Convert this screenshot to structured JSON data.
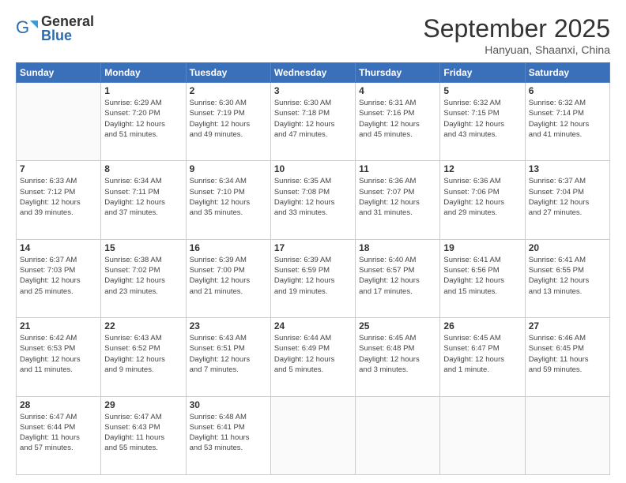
{
  "logo": {
    "general": "General",
    "blue": "Blue"
  },
  "header": {
    "month_title": "September 2025",
    "location": "Hanyuan, Shaanxi, China"
  },
  "weekdays": [
    "Sunday",
    "Monday",
    "Tuesday",
    "Wednesday",
    "Thursday",
    "Friday",
    "Saturday"
  ],
  "weeks": [
    [
      {
        "day": "",
        "info": ""
      },
      {
        "day": "1",
        "info": "Sunrise: 6:29 AM\nSunset: 7:20 PM\nDaylight: 12 hours\nand 51 minutes."
      },
      {
        "day": "2",
        "info": "Sunrise: 6:30 AM\nSunset: 7:19 PM\nDaylight: 12 hours\nand 49 minutes."
      },
      {
        "day": "3",
        "info": "Sunrise: 6:30 AM\nSunset: 7:18 PM\nDaylight: 12 hours\nand 47 minutes."
      },
      {
        "day": "4",
        "info": "Sunrise: 6:31 AM\nSunset: 7:16 PM\nDaylight: 12 hours\nand 45 minutes."
      },
      {
        "day": "5",
        "info": "Sunrise: 6:32 AM\nSunset: 7:15 PM\nDaylight: 12 hours\nand 43 minutes."
      },
      {
        "day": "6",
        "info": "Sunrise: 6:32 AM\nSunset: 7:14 PM\nDaylight: 12 hours\nand 41 minutes."
      }
    ],
    [
      {
        "day": "7",
        "info": "Sunrise: 6:33 AM\nSunset: 7:12 PM\nDaylight: 12 hours\nand 39 minutes."
      },
      {
        "day": "8",
        "info": "Sunrise: 6:34 AM\nSunset: 7:11 PM\nDaylight: 12 hours\nand 37 minutes."
      },
      {
        "day": "9",
        "info": "Sunrise: 6:34 AM\nSunset: 7:10 PM\nDaylight: 12 hours\nand 35 minutes."
      },
      {
        "day": "10",
        "info": "Sunrise: 6:35 AM\nSunset: 7:08 PM\nDaylight: 12 hours\nand 33 minutes."
      },
      {
        "day": "11",
        "info": "Sunrise: 6:36 AM\nSunset: 7:07 PM\nDaylight: 12 hours\nand 31 minutes."
      },
      {
        "day": "12",
        "info": "Sunrise: 6:36 AM\nSunset: 7:06 PM\nDaylight: 12 hours\nand 29 minutes."
      },
      {
        "day": "13",
        "info": "Sunrise: 6:37 AM\nSunset: 7:04 PM\nDaylight: 12 hours\nand 27 minutes."
      }
    ],
    [
      {
        "day": "14",
        "info": "Sunrise: 6:37 AM\nSunset: 7:03 PM\nDaylight: 12 hours\nand 25 minutes."
      },
      {
        "day": "15",
        "info": "Sunrise: 6:38 AM\nSunset: 7:02 PM\nDaylight: 12 hours\nand 23 minutes."
      },
      {
        "day": "16",
        "info": "Sunrise: 6:39 AM\nSunset: 7:00 PM\nDaylight: 12 hours\nand 21 minutes."
      },
      {
        "day": "17",
        "info": "Sunrise: 6:39 AM\nSunset: 6:59 PM\nDaylight: 12 hours\nand 19 minutes."
      },
      {
        "day": "18",
        "info": "Sunrise: 6:40 AM\nSunset: 6:57 PM\nDaylight: 12 hours\nand 17 minutes."
      },
      {
        "day": "19",
        "info": "Sunrise: 6:41 AM\nSunset: 6:56 PM\nDaylight: 12 hours\nand 15 minutes."
      },
      {
        "day": "20",
        "info": "Sunrise: 6:41 AM\nSunset: 6:55 PM\nDaylight: 12 hours\nand 13 minutes."
      }
    ],
    [
      {
        "day": "21",
        "info": "Sunrise: 6:42 AM\nSunset: 6:53 PM\nDaylight: 12 hours\nand 11 minutes."
      },
      {
        "day": "22",
        "info": "Sunrise: 6:43 AM\nSunset: 6:52 PM\nDaylight: 12 hours\nand 9 minutes."
      },
      {
        "day": "23",
        "info": "Sunrise: 6:43 AM\nSunset: 6:51 PM\nDaylight: 12 hours\nand 7 minutes."
      },
      {
        "day": "24",
        "info": "Sunrise: 6:44 AM\nSunset: 6:49 PM\nDaylight: 12 hours\nand 5 minutes."
      },
      {
        "day": "25",
        "info": "Sunrise: 6:45 AM\nSunset: 6:48 PM\nDaylight: 12 hours\nand 3 minutes."
      },
      {
        "day": "26",
        "info": "Sunrise: 6:45 AM\nSunset: 6:47 PM\nDaylight: 12 hours\nand 1 minute."
      },
      {
        "day": "27",
        "info": "Sunrise: 6:46 AM\nSunset: 6:45 PM\nDaylight: 11 hours\nand 59 minutes."
      }
    ],
    [
      {
        "day": "28",
        "info": "Sunrise: 6:47 AM\nSunset: 6:44 PM\nDaylight: 11 hours\nand 57 minutes."
      },
      {
        "day": "29",
        "info": "Sunrise: 6:47 AM\nSunset: 6:43 PM\nDaylight: 11 hours\nand 55 minutes."
      },
      {
        "day": "30",
        "info": "Sunrise: 6:48 AM\nSunset: 6:41 PM\nDaylight: 11 hours\nand 53 minutes."
      },
      {
        "day": "",
        "info": ""
      },
      {
        "day": "",
        "info": ""
      },
      {
        "day": "",
        "info": ""
      },
      {
        "day": "",
        "info": ""
      }
    ]
  ]
}
